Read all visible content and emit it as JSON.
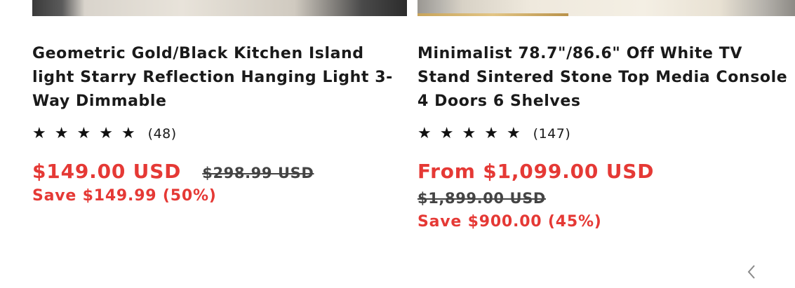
{
  "products": [
    {
      "title": "Geometric Gold/Black Kitchen Island light Starry Reflection Hanging Light 3-Way Dimmable",
      "rating_stars": 5,
      "review_count": "(48)",
      "price": "$149.00 USD",
      "compare_price": "$298.99 USD",
      "save_text": "Save $149.99 (50%)"
    },
    {
      "title": "Minimalist 78.7\"/86.6\" Off White TV Stand Sintered Stone Top Media Console 4 Doors 6 Shelves",
      "rating_stars": 5,
      "review_count": "(147)",
      "price": "From $1,099.00 USD",
      "compare_price": "$1,899.00 USD",
      "save_text": "Save $900.00 (45%)"
    }
  ],
  "icons": {
    "star": "star-icon",
    "carousel_prev": "chevron-left-icon"
  },
  "colors": {
    "sale_price": "#e53935",
    "text": "#1a1a1a",
    "compare_price": "#444444"
  }
}
